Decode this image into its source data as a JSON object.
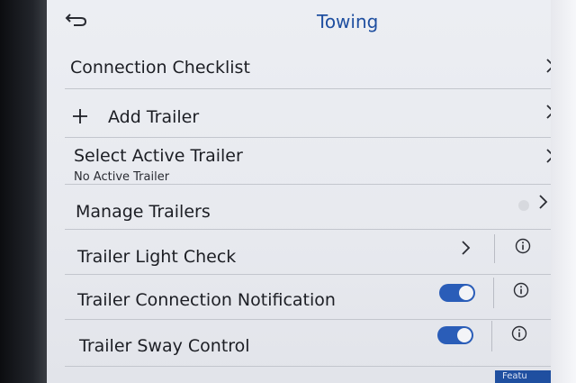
{
  "header": {
    "title": "Towing"
  },
  "rows": [
    {
      "label": "Connection Checklist"
    },
    {
      "label": "Add Trailer"
    },
    {
      "label": "Select Active Trailer",
      "sublabel": "No Active Trailer"
    },
    {
      "label": "Manage Trailers"
    },
    {
      "label": "Trailer Light Check"
    },
    {
      "label": "Trailer Connection Notification",
      "toggle_on": true
    },
    {
      "label": "Trailer Sway Control",
      "toggle_on": true
    }
  ],
  "footer": {
    "tab_label": "Featu"
  },
  "colors": {
    "accent": "#2a5db8",
    "title": "#1f4fa0"
  },
  "icons": [
    "back-arrow-icon",
    "plus-icon",
    "chevron-right-icon",
    "info-icon"
  ]
}
